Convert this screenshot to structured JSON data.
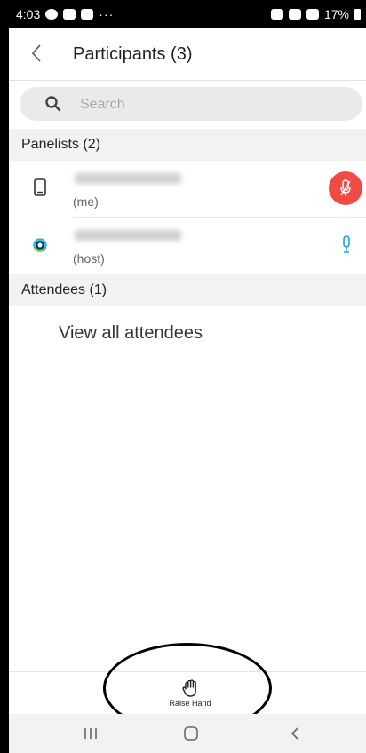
{
  "status_bar": {
    "time": "4:03",
    "more": "···",
    "battery": "17%"
  },
  "header": {
    "title": "Participants (3)"
  },
  "search": {
    "placeholder": "Search"
  },
  "panelists": {
    "heading": "Panelists (2)",
    "items": [
      {
        "role": "(me)",
        "device_icon": "phone-icon",
        "mic_state": "muted"
      },
      {
        "role": "(host)",
        "device_icon": "webex-icon",
        "mic_state": "unmuted"
      }
    ]
  },
  "attendees": {
    "heading": "Attendees (1)",
    "view_all": "View all attendees"
  },
  "footer": {
    "raise_hand": "Raise Hand"
  },
  "colors": {
    "mute_red": "#f04a44",
    "mic_blue": "#1aa3d9",
    "section_bg": "#f2f2f2"
  }
}
